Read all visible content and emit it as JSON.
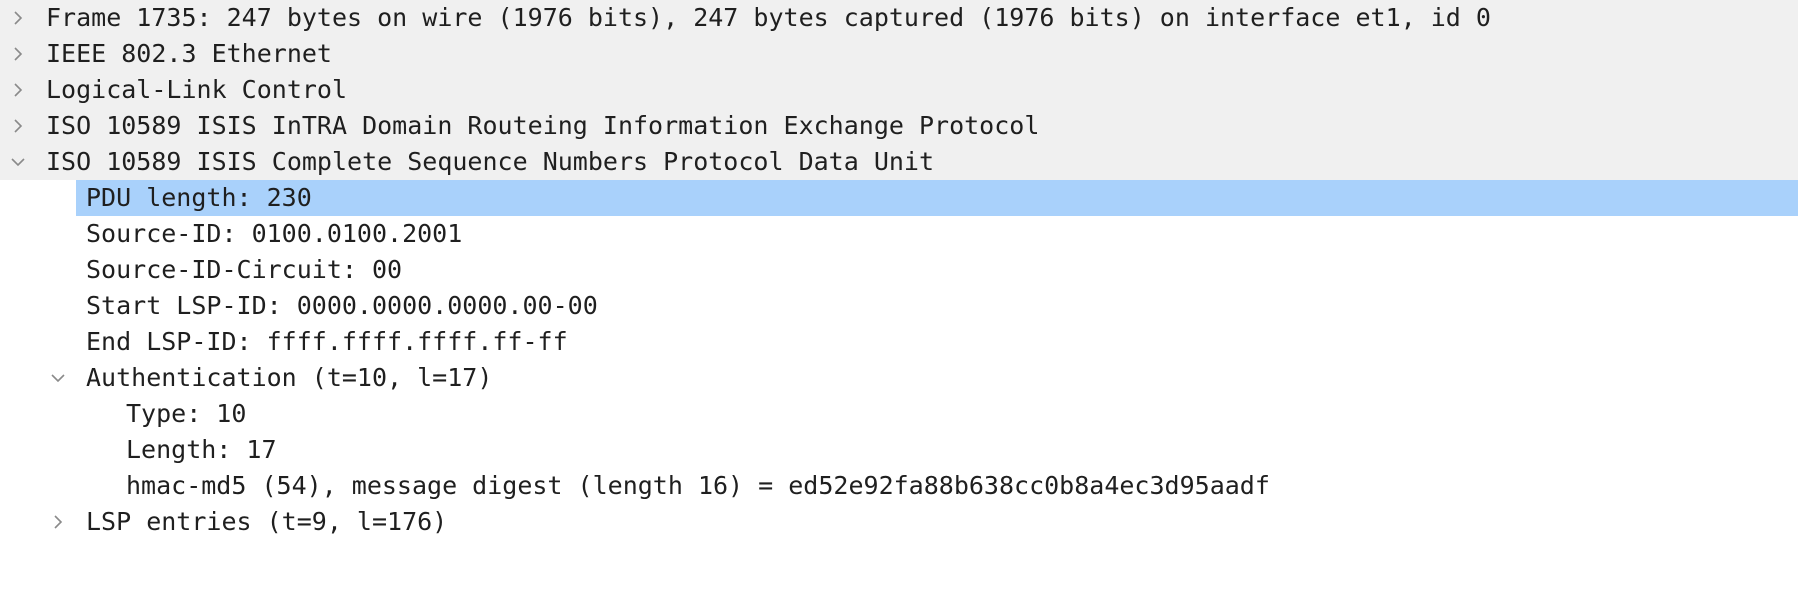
{
  "tree": {
    "frame": "Frame 1735: 247 bytes on wire (1976 bits), 247 bytes captured (1976 bits) on interface et1, id 0",
    "ethernet": "IEEE 802.3 Ethernet",
    "llc": "Logical-Link Control",
    "isis_intra": "ISO 10589 ISIS InTRA Domain Routeing Information Exchange Protocol",
    "csnp": "ISO 10589 ISIS Complete Sequence Numbers Protocol Data Unit",
    "pdu_length": "PDU length: 230",
    "source_id": "Source-ID: 0100.0100.2001",
    "source_id_circuit": "Source-ID-Circuit: 00",
    "start_lsp_id": "Start LSP-ID: 0000.0000.0000.00-00",
    "end_lsp_id": "End LSP-ID: ffff.ffff.ffff.ff-ff",
    "authentication": "Authentication (t=10, l=17)",
    "auth_type": "Type: 10",
    "auth_length": "Length: 17",
    "auth_digest": "hmac-md5 (54), message digest (length 16) = ed52e92fa88b638cc0b8a4ec3d95aadf",
    "lsp_entries": "LSP entries (t=9, l=176)"
  },
  "icons": {
    "collapsed": "chevron-right-icon",
    "expanded": "chevron-down-icon"
  },
  "colors": {
    "selection": "#a9d1fb",
    "top_level_bg": "#f0f0f0",
    "chevron": "#8a8a8a"
  }
}
